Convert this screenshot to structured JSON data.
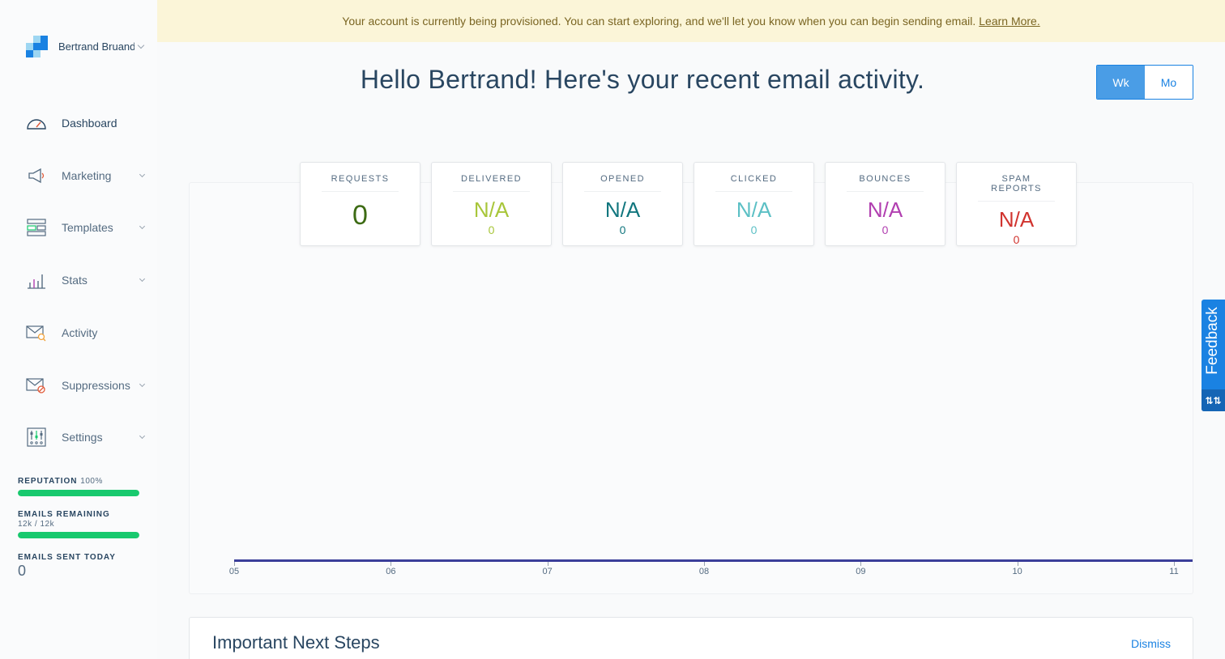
{
  "banner": {
    "message": "Your account is currently being provisioned. You can start exploring, and we'll let you know when you can begin sending email.",
    "link_label": "Learn More."
  },
  "account": {
    "name": "Bertrand Bruand"
  },
  "nav": {
    "dashboard": "Dashboard",
    "marketing": "Marketing",
    "templates": "Templates",
    "stats": "Stats",
    "activity": "Activity",
    "suppressions": "Suppressions",
    "settings": "Settings"
  },
  "meters": {
    "reputation_label": "REPUTATION",
    "reputation_value": "100%",
    "reputation_fraction": 1.0,
    "remaining_label": "EMAILS REMAINING",
    "remaining_value": "12k / 12k",
    "remaining_fraction": 1.0,
    "sent_label": "EMAILS SENT TODAY",
    "sent_value": "0"
  },
  "heading": "Hello Bertrand! Here's your recent email activity.",
  "period_toggle": {
    "week": "Wk",
    "month": "Mo",
    "selected": "Wk"
  },
  "stats": [
    {
      "label": "REQUESTS",
      "value": "0",
      "count": "",
      "color": "#3d6b14"
    },
    {
      "label": "DELIVERED",
      "value": "N/A",
      "count": "0",
      "color": "#a8c63a"
    },
    {
      "label": "OPENED",
      "value": "N/A",
      "count": "0",
      "color": "#11767e"
    },
    {
      "label": "CLICKED",
      "value": "N/A",
      "count": "0",
      "color": "#5cc0c5"
    },
    {
      "label": "BOUNCES",
      "value": "N/A",
      "count": "0",
      "color": "#b13fb0"
    },
    {
      "label": "SPAM REPORTS",
      "value": "N/A",
      "count": "0",
      "color": "#d1342f"
    }
  ],
  "chart_data": {
    "type": "line",
    "x": [
      "05",
      "06",
      "07",
      "08",
      "09",
      "10",
      "11"
    ],
    "series": [
      {
        "values": [
          0,
          0,
          0,
          0,
          0,
          0,
          0
        ],
        "color": "#3b3e9a"
      }
    ]
  },
  "next_steps": {
    "title": "Important Next Steps",
    "dismiss": "Dismiss"
  },
  "feedback": {
    "label": "Feedback"
  },
  "colors": {
    "accent": "#1a82e2",
    "meter": "#18c96e",
    "banner_bg": "#fbf5d8"
  },
  "icons": {
    "dashboard": "gauge-icon",
    "marketing": "megaphone-icon",
    "templates": "templates-icon",
    "stats": "bar-chart-icon",
    "activity": "mail-search-icon",
    "suppressions": "mail-block-icon",
    "settings": "sliders-icon"
  }
}
